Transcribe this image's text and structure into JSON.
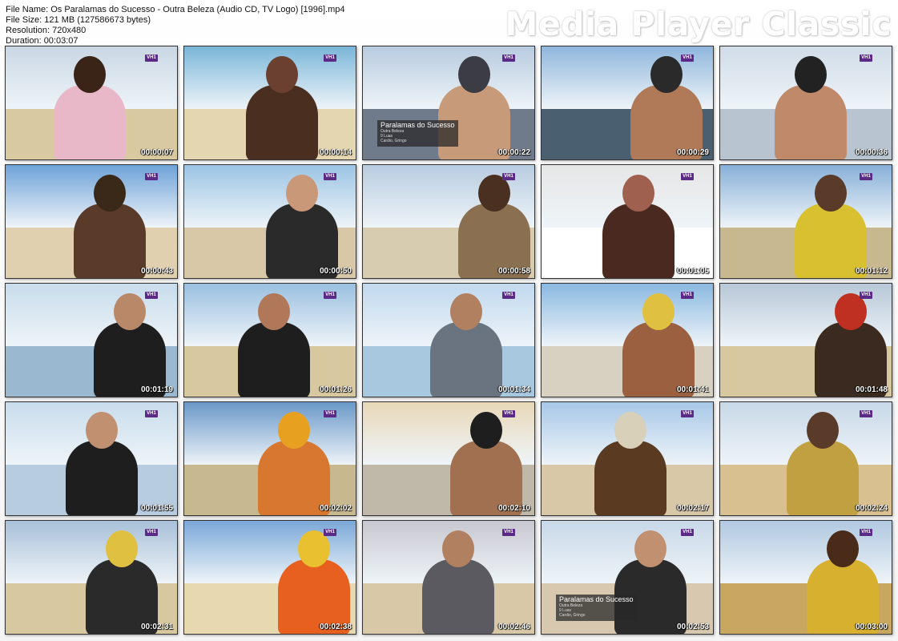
{
  "header": {
    "file_name_line": "File Name: Os Paralamas do Sucesso - Outra Beleza (Audio CD, TV Logo) [1996].mp4",
    "file_size_line": "File Size: 121 MB (127586673 bytes)",
    "resolution_line": "Resolution: 720x480",
    "duration_line": "Duration: 00:03:07",
    "app_brand": "Media Player Classic"
  },
  "tv_logo_text": "VH1",
  "caption": {
    "title": "Paralamas do Sucesso",
    "lines": [
      "Outra Beleza",
      "9 Luas",
      "Cardio, Gringo"
    ]
  },
  "thumbnails": [
    {
      "time": "00:00:07"
    },
    {
      "time": "00:00:14"
    },
    {
      "time": "00:00:22"
    },
    {
      "time": "00:00:29"
    },
    {
      "time": "00:00:36"
    },
    {
      "time": "00:00:43"
    },
    {
      "time": "00:00:50"
    },
    {
      "time": "00:00:58"
    },
    {
      "time": "00:01:05"
    },
    {
      "time": "00:01:12"
    },
    {
      "time": "00:01:19"
    },
    {
      "time": "00:01:26"
    },
    {
      "time": "00:01:34"
    },
    {
      "time": "00:01:41"
    },
    {
      "time": "00:01:48"
    },
    {
      "time": "00:01:55"
    },
    {
      "time": "00:02:02"
    },
    {
      "time": "00:02:10"
    },
    {
      "time": "00:02:17"
    },
    {
      "time": "00:02:24"
    },
    {
      "time": "00:02:31"
    },
    {
      "time": "00:02:38"
    },
    {
      "time": "00:02:46"
    },
    {
      "time": "00:02:53"
    },
    {
      "time": "00:03:00"
    }
  ]
}
